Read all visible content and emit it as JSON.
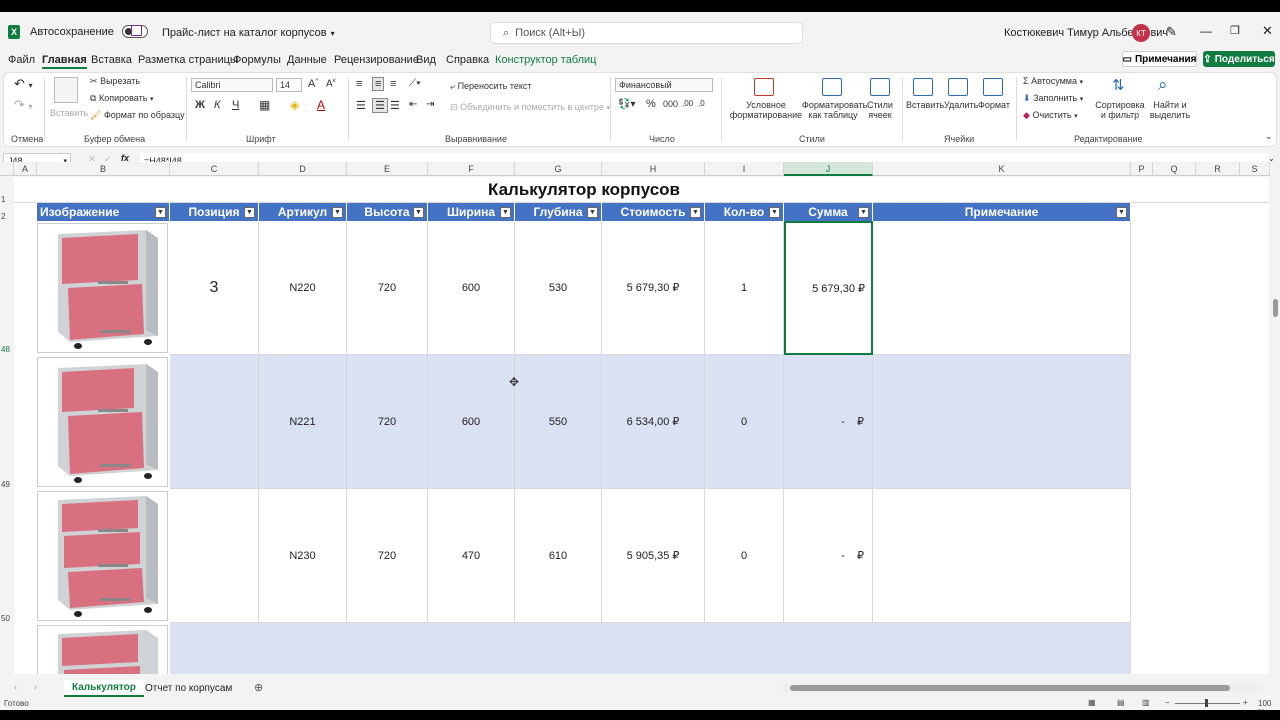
{
  "titlebar": {
    "autosave_label": "Автосохранение",
    "doc_title": "Прайс-лист на каталог корпусов",
    "search_placeholder": "Поиск (Alt+Ы)",
    "user_name": "Костюкевич Тимур Альбертович",
    "user_initials": "КТ"
  },
  "menu": {
    "tabs": [
      "Файл",
      "Главная",
      "Вставка",
      "Разметка страницы",
      "Формулы",
      "Данные",
      "Рецензирование",
      "Вид",
      "Справка",
      "Конструктор таблиц"
    ],
    "notes_label": "Примечания",
    "share_label": "Поделиться"
  },
  "ribbon": {
    "undo_group": "Отмена",
    "clipboard": {
      "paste": "Вставить",
      "cut": "Вырезать",
      "copy": "Копировать",
      "format_painter": "Формат по образцу",
      "group": "Буфер обмена"
    },
    "font": {
      "name": "Calibri",
      "size": "14",
      "bold": "Ж",
      "italic": "К",
      "underline": "Ч",
      "group": "Шрифт"
    },
    "alignment": {
      "wrap": "Переносить текст",
      "merge": "Объединить и поместить в центре",
      "group": "Выравнивание"
    },
    "number": {
      "format": "Финансовый",
      "group": "Число"
    },
    "styles": {
      "conditional": "Условное форматирование",
      "as_table": "Форматировать как таблицу",
      "cell_styles": "Стили ячеек",
      "group": "Стили"
    },
    "cells": {
      "insert": "Вставить",
      "delete": "Удалить",
      "format": "Формат",
      "group": "Ячейки"
    },
    "editing": {
      "autosum": "Автосумма",
      "fill": "Заполнить",
      "clear": "Очистить",
      "sort": "Сортировка и фильтр",
      "find": "Найти и выделить",
      "group": "Редактирование"
    }
  },
  "formula_bar": {
    "cell_ref": "J48",
    "formula": "=H48*I48"
  },
  "columns": [
    "A",
    "B",
    "C",
    "D",
    "E",
    "F",
    "G",
    "H",
    "I",
    "J",
    "K",
    "P",
    "Q",
    "R",
    "S"
  ],
  "table": {
    "title": "Калькулятор корпусов",
    "headers": [
      "Изображение",
      "Позиция",
      "Артикул",
      "Высота",
      "Ширина",
      "Глубина",
      "Стоимость",
      "Кол-во",
      "Сумма",
      "Примечание"
    ],
    "rows": [
      {
        "row": "48",
        "position": "3",
        "article": "N220",
        "height": "720",
        "width": "600",
        "depth": "530",
        "price": "5 679,30 ₽",
        "qty": "1",
        "sum": "5 679,30 ₽",
        "drawers": 2
      },
      {
        "row": "49",
        "position": "",
        "article": "N221",
        "height": "720",
        "width": "600",
        "depth": "550",
        "price": "6 534,00 ₽",
        "qty": "0",
        "sum": "-    ₽",
        "drawers": 2
      },
      {
        "row": "50",
        "position": "",
        "article": "N230",
        "height": "720",
        "width": "470",
        "depth": "610",
        "price": "5 905,35 ₽",
        "qty": "0",
        "sum": "-    ₽",
        "drawers": 3
      }
    ]
  },
  "row_numbers": [
    "1",
    "2",
    "48",
    "49",
    "50"
  ],
  "sheets": [
    "Калькулятор",
    "Отчет по корпусам"
  ],
  "status": {
    "ready": "Готово",
    "zoom": "100 %"
  }
}
